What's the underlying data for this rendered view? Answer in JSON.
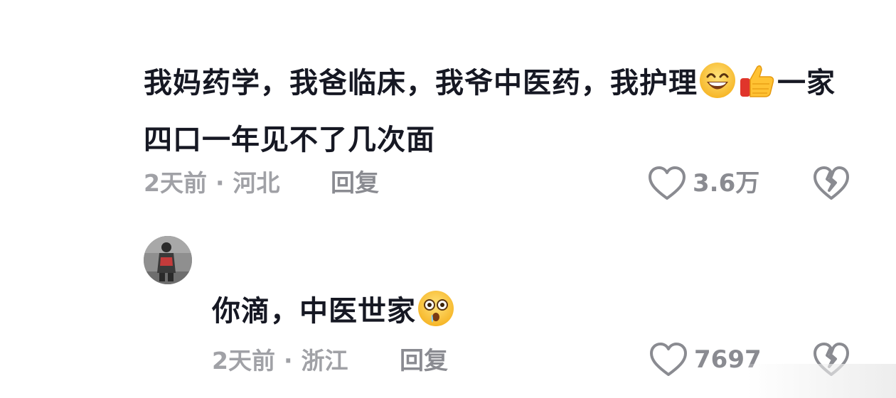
{
  "comments": [
    {
      "text_part1": "我妈药学，我爸临床，我爷中医药，我护理",
      "emojis_1": [
        "grin-emoji",
        "thumbs-up-emoji"
      ],
      "text_part2": "一家四口一年见不了几次面",
      "time": "2天前",
      "location": "河北",
      "separator": "·",
      "reply_label": "回复",
      "like_count": "3.6万"
    },
    {
      "text_part1": "你滴，中医世家",
      "emojis_1": [
        "astonished-drool-emoji"
      ],
      "time": "2天前",
      "location": "浙江",
      "separator": "·",
      "reply_label": "回复",
      "like_count": "7697"
    }
  ],
  "colors": {
    "text": "#161823",
    "meta": "#a0a1a6",
    "icon": "#8a8b91",
    "background": "#ffffff"
  }
}
